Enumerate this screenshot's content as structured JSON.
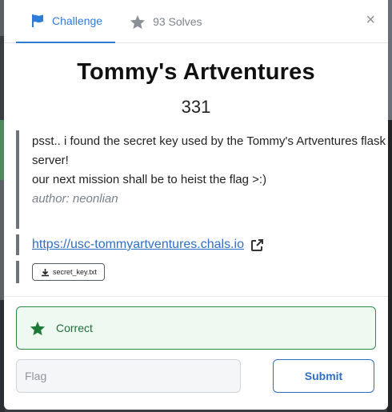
{
  "tabs": {
    "challenge_label": "Challenge",
    "solves_label": "93 Solves"
  },
  "close_label": "×",
  "challenge": {
    "title": "Tommy's Artventures",
    "points": "331",
    "description_line1": "psst.. i found the secret key used by the Tommy's Artventures flask server!",
    "description_line2": "our next mission shall be to heist the flag >:)",
    "author": "author: neonlian",
    "link": "https://usc-tommyartventures.chals.io",
    "file_name": "secret_key.txt"
  },
  "status": {
    "message": "Correct"
  },
  "form": {
    "flag_placeholder": "Flag",
    "submit_label": "Submit"
  },
  "colors": {
    "accent": "#2f7bd8",
    "success": "#2e8b47",
    "success_bg": "#eef9f1"
  },
  "icons": {
    "challenge_tab": "flag-icon",
    "solves_tab": "star-icon",
    "link": "external-link-icon",
    "file": "download-icon",
    "status": "star-icon"
  }
}
